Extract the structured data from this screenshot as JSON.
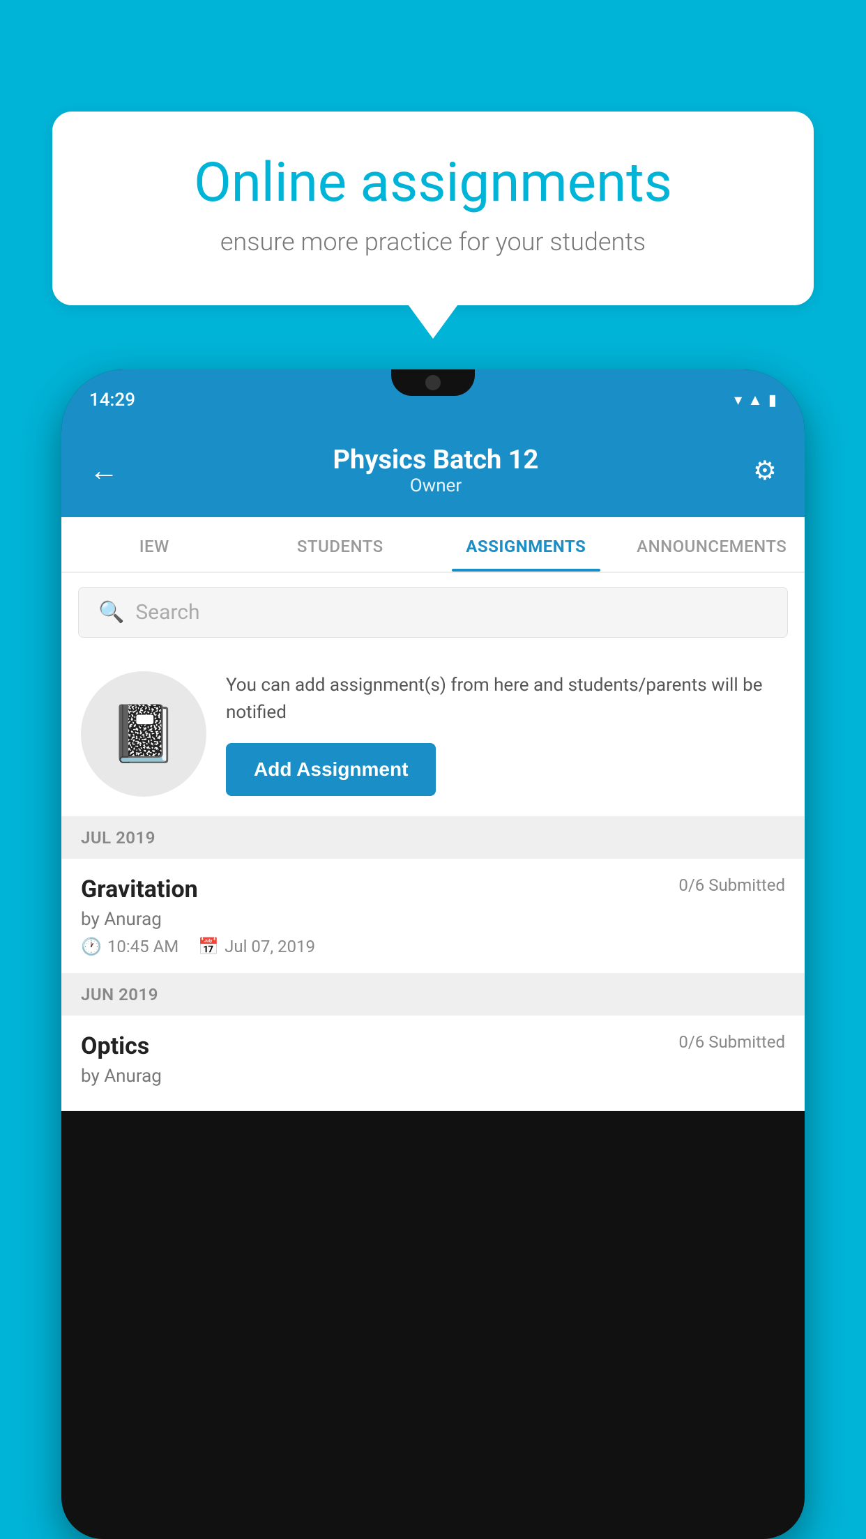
{
  "background": {
    "color": "#00B4D8"
  },
  "speech_bubble": {
    "title": "Online assignments",
    "subtitle": "ensure more practice for your students"
  },
  "phone": {
    "status_bar": {
      "time": "14:29",
      "icons": [
        "wifi",
        "signal",
        "battery"
      ]
    },
    "header": {
      "title": "Physics Batch 12",
      "subtitle": "Owner",
      "back_label": "←",
      "settings_label": "⚙"
    },
    "tabs": [
      {
        "label": "IEW",
        "active": false
      },
      {
        "label": "STUDENTS",
        "active": false
      },
      {
        "label": "ASSIGNMENTS",
        "active": true
      },
      {
        "label": "ANNOUNCEMENTS",
        "active": false
      }
    ],
    "search": {
      "placeholder": "Search"
    },
    "promo": {
      "description": "You can add assignment(s) from here and students/parents will be notified",
      "button_label": "Add Assignment"
    },
    "sections": [
      {
        "month_label": "JUL 2019",
        "assignments": [
          {
            "name": "Gravitation",
            "submitted": "0/6 Submitted",
            "by": "by Anurag",
            "time": "10:45 AM",
            "date": "Jul 07, 2019"
          }
        ]
      },
      {
        "month_label": "JUN 2019",
        "assignments": [
          {
            "name": "Optics",
            "submitted": "0/6 Submitted",
            "by": "by Anurag",
            "time": "",
            "date": ""
          }
        ]
      }
    ]
  }
}
